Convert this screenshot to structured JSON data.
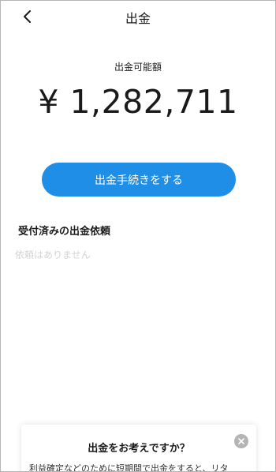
{
  "header": {
    "title": "出金",
    "back_icon": "chevron-left-icon"
  },
  "balance": {
    "label": "出金可能額",
    "amount": "¥ 1,282,711"
  },
  "actions": {
    "withdraw_label": "出金手続きをする",
    "button_color": "#1e8ee6"
  },
  "requests": {
    "section_title": "受付済みの出金依頼",
    "empty_text": "依頼はありません"
  },
  "promo": {
    "title": "出金をお考えですか？",
    "body": "利益確定などのために短期間で出金をすると、リタ",
    "close_icon": "close-icon"
  }
}
